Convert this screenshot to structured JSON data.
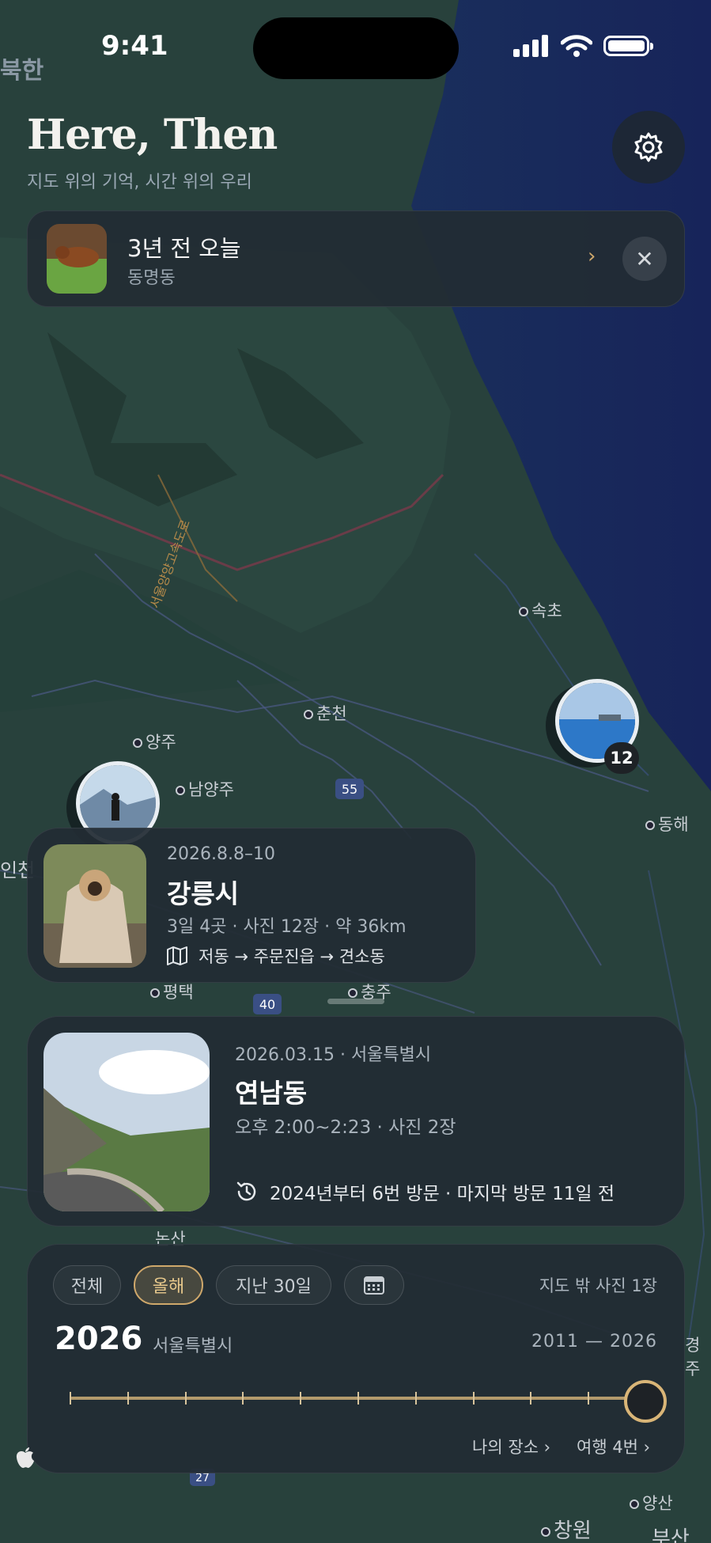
{
  "status_bar": {
    "time": "9:41",
    "signal_icon": "cellular-signal-icon",
    "wifi_icon": "wifi-icon",
    "battery_icon": "battery-icon"
  },
  "header": {
    "title": "Here, Then",
    "subtitle": "지도 위의 기억, 시간 위의 우리",
    "settings_icon": "gear-icon"
  },
  "memory_banner": {
    "title": "3년 전 오늘",
    "place": "동명동",
    "chevron": "›",
    "close": "✕"
  },
  "map": {
    "labels": [
      {
        "name": "북한"
      },
      {
        "name": "속초"
      },
      {
        "name": "춘천"
      },
      {
        "name": "양주"
      },
      {
        "name": "남양주"
      },
      {
        "name": "동해"
      },
      {
        "name": "인천"
      },
      {
        "name": "평택"
      },
      {
        "name": "충주"
      },
      {
        "name": "논산"
      },
      {
        "name": "경주"
      },
      {
        "name": "양산"
      },
      {
        "name": "창원"
      },
      {
        "name": "부산"
      }
    ],
    "road_shields": [
      "55",
      "40",
      "27"
    ],
    "highway_label": "서울양양고속도로",
    "clusters": [
      {
        "count": "12"
      }
    ],
    "legal_icon": "apple-maps-logo"
  },
  "trip_card": {
    "date": "2026.8.8–10",
    "name": "강릉시",
    "meta": "3일 4곳 · 사진 12장 · 약 36km",
    "route_icon": "map-icon",
    "route": "저동 → 주문진읍 → 견소동"
  },
  "place_card": {
    "date": "2026.03.15 · 서울특별시",
    "name": "연남동",
    "time": "오후 2:00~2:23 · 사진 2장",
    "history_icon": "history-icon",
    "history": "2024년부터 6번 방문 · 마지막 방문 11일 전"
  },
  "timeline": {
    "chips": [
      "전체",
      "올해",
      "지난 30일"
    ],
    "active_chip": "올해",
    "calendar_icon": "calendar-icon",
    "outside_photos": "지도 밖 사진 1장",
    "year": "2026",
    "region": "서울특별시",
    "range": "2011 — 2026",
    "slider_value": 2026,
    "slider_min": 2011,
    "slider_max": 2026,
    "links": {
      "places": "나의 장소 ›",
      "trips": "여행 4번 ›"
    }
  },
  "colors": {
    "accent": "#cfa86b",
    "card_bg": "#222c34",
    "map_land": "#263f3a",
    "map_sea": "#1a2b5a"
  }
}
